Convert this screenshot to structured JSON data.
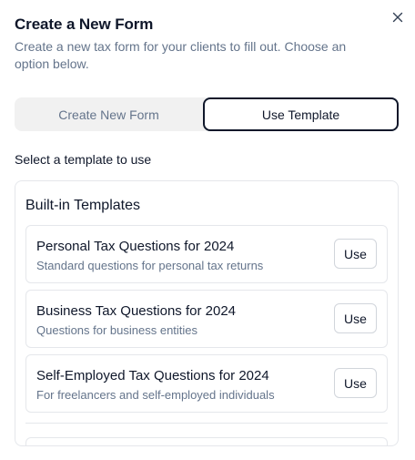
{
  "dialog": {
    "title": "Create a New Form",
    "subtitle": "Create a new tax form for your clients to fill out. Choose an option below.",
    "close_icon": "close-icon"
  },
  "mode_toggle": {
    "options": [
      {
        "label": "Create New Form",
        "selected": false
      },
      {
        "label": "Use Template",
        "selected": true
      }
    ]
  },
  "template_section": {
    "label": "Select a template to use",
    "panel_heading": "Built-in Templates",
    "templates": [
      {
        "title": "Personal Tax Questions for 2024",
        "description": "Standard questions for personal tax returns",
        "button_label": "Use"
      },
      {
        "title": "Business Tax Questions for 2024",
        "description": "Questions for business entities",
        "button_label": "Use"
      },
      {
        "title": "Self-Employed Tax Questions for 2024",
        "description": "For freelancers and self-employed individuals",
        "button_label": "Use"
      }
    ]
  },
  "colors": {
    "text_primary": "#0f172a",
    "text_muted": "#64748b",
    "border": "#e5e7eb",
    "toggle_bg": "#f1f1f1"
  }
}
